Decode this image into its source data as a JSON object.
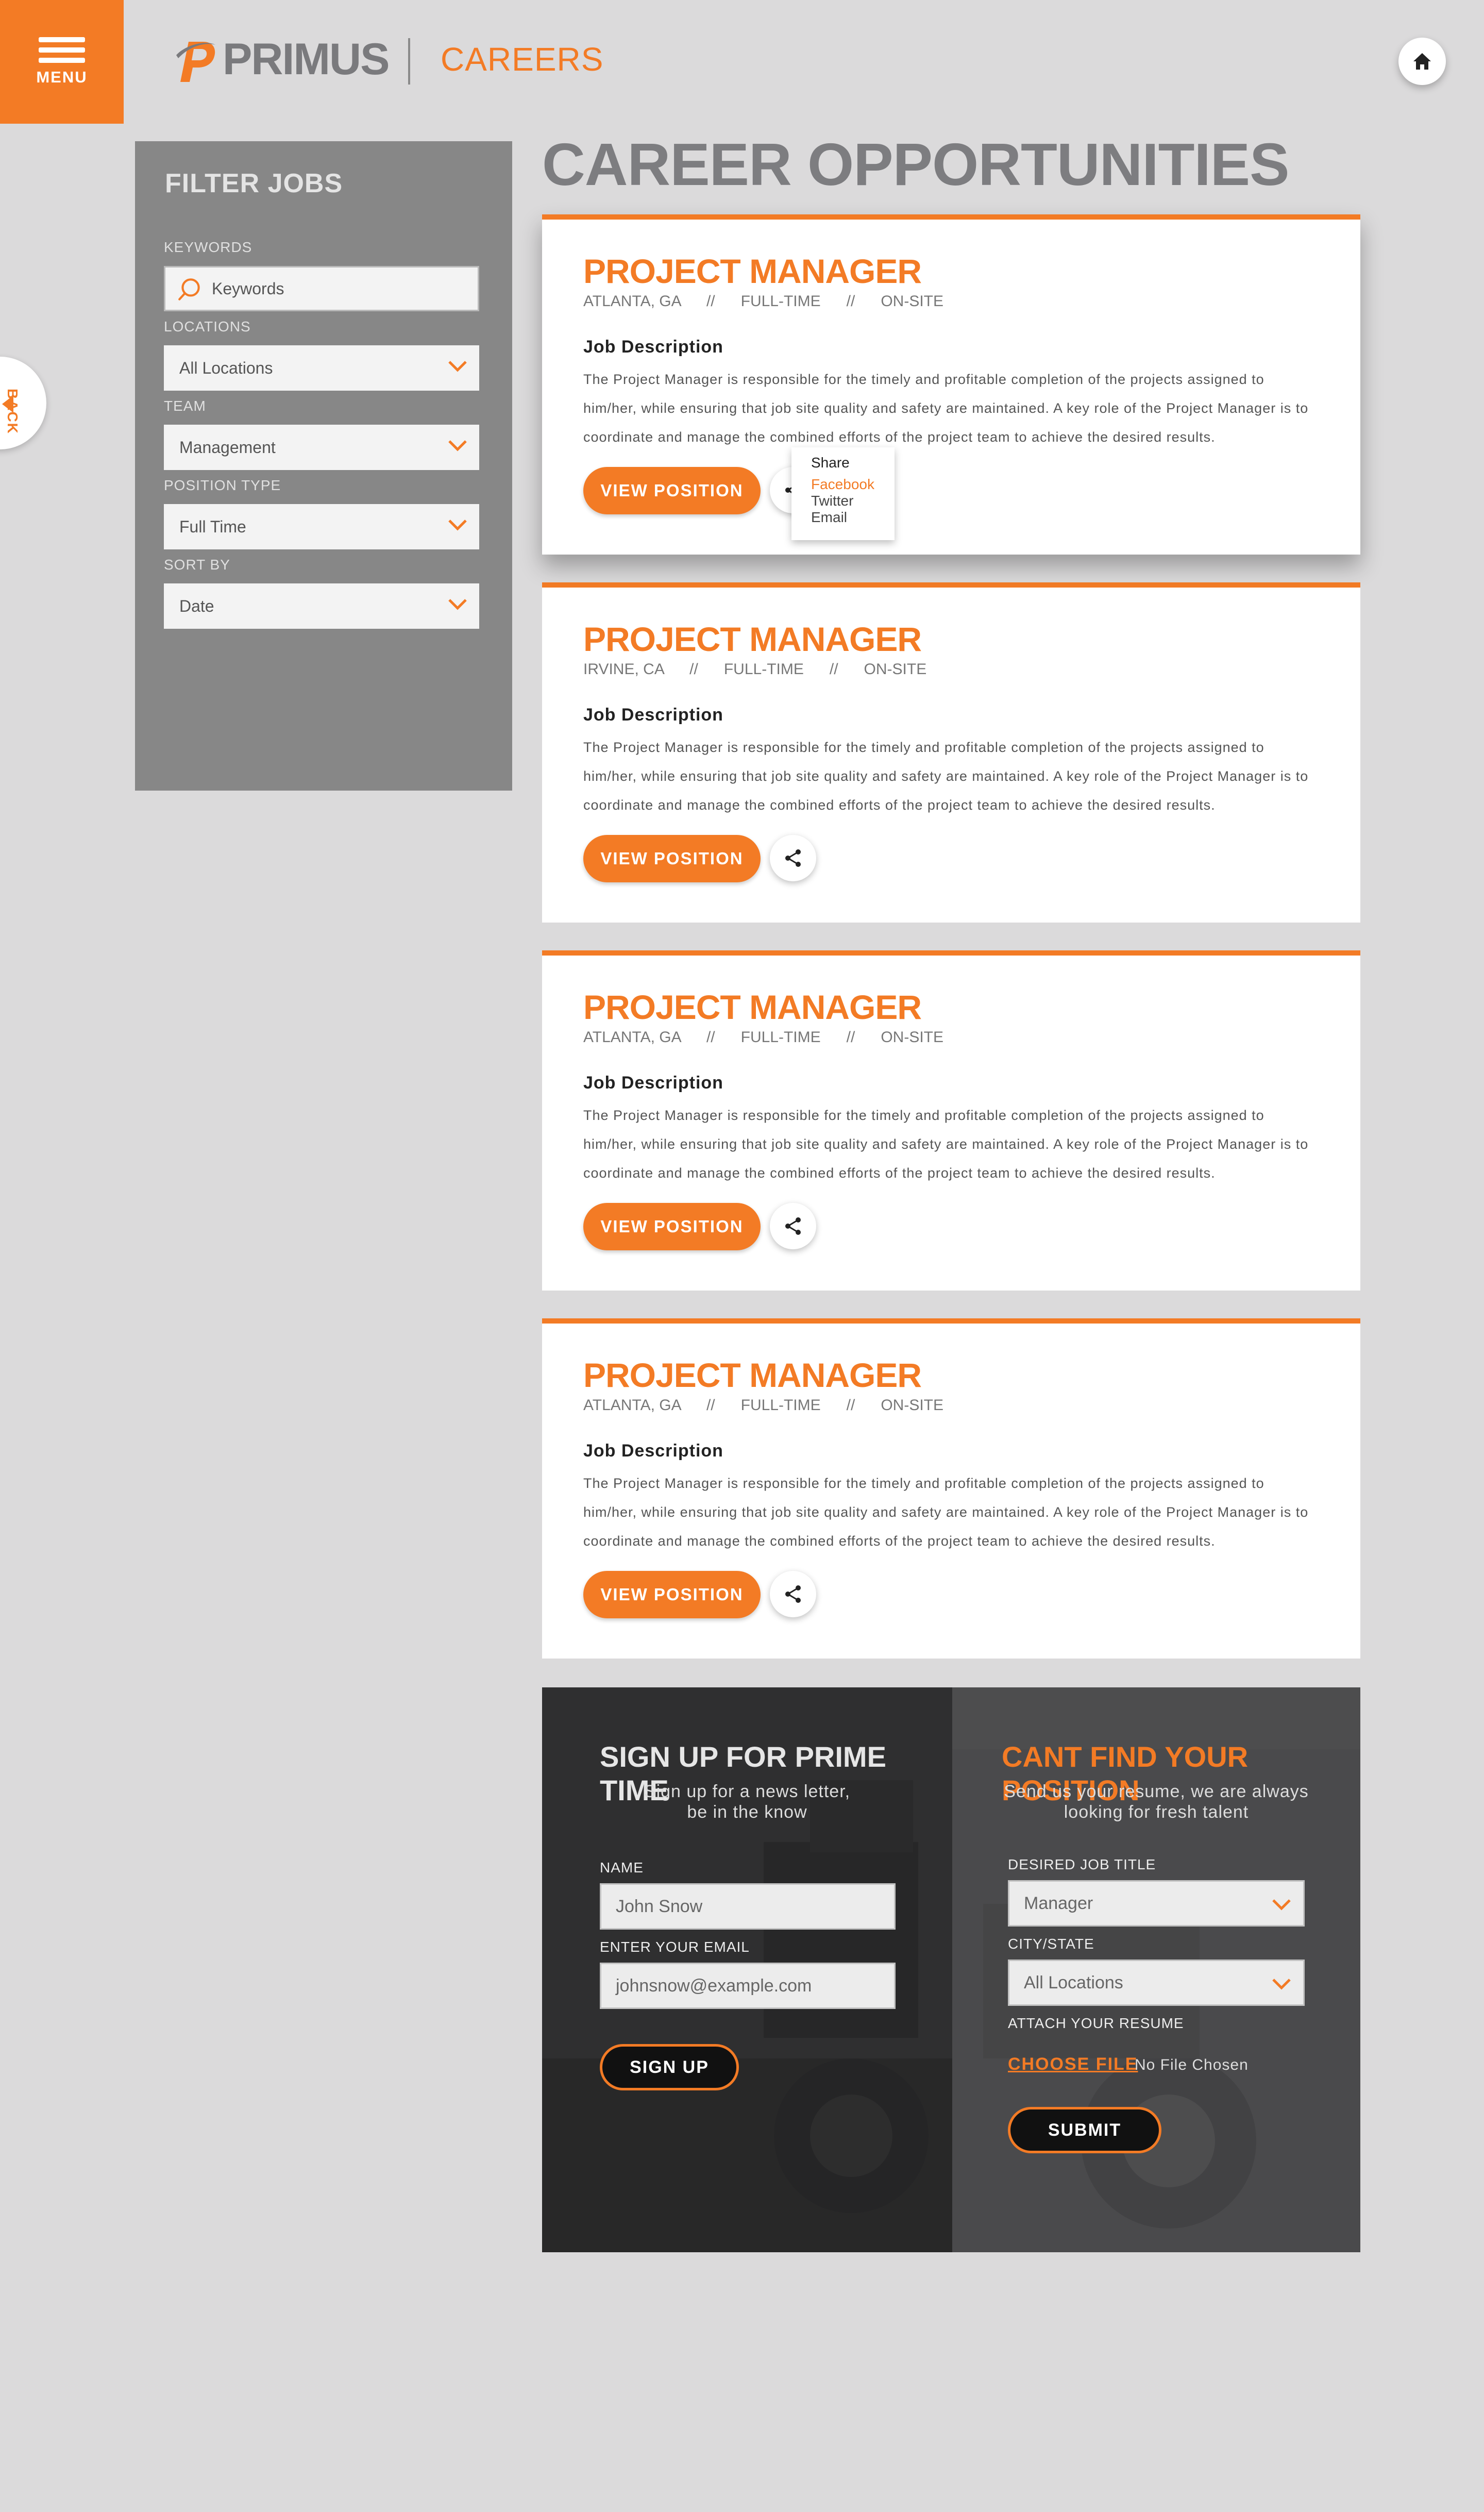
{
  "header": {
    "menu_label": "MENU",
    "logo_text": "PRIMUS",
    "section_title": "CAREERS",
    "back_label": "BACK"
  },
  "filter": {
    "title": "FILTER JOBS",
    "keywords_label": "KEYWORDS",
    "keywords_placeholder": "Keywords",
    "locations_label": "LOCATIONS",
    "locations_value": "All Locations",
    "team_label": "TEAM",
    "team_value": "Management",
    "position_type_label": "POSITION TYPE",
    "position_type_value": "Full Time",
    "sort_label": "SORT BY",
    "sort_value": "Date"
  },
  "page_title": "CAREER OPPORTUNITIES",
  "jobs": [
    {
      "title": "PROJECT MANAGER",
      "meta": "ATLANTA, GA      //      FULL-TIME      //      ON-SITE",
      "jd_label": "Job Description",
      "description": "The Project Manager is responsible for the timely and profitable completion of the projects assigned to him/her, while ensuring that job site quality and safety are maintained. A key role of the Project Manager is to coordinate and manage the combined efforts of the project team to achieve the desired results.",
      "button": "VIEW POSITION"
    },
    {
      "title": "PROJECT MANAGER",
      "meta": "IRVINE, CA      //      FULL-TIME      //      ON-SITE",
      "jd_label": "Job Description",
      "description": "The Project Manager is responsible for the timely and profitable completion of the projects assigned to him/her, while ensuring that job site quality and safety are maintained. A key role of the Project Manager is to coordinate and manage the combined efforts of the project team to achieve the desired results.",
      "button": "VIEW POSITION"
    },
    {
      "title": "PROJECT MANAGER",
      "meta": "ATLANTA, GA      //      FULL-TIME      //      ON-SITE",
      "jd_label": "Job Description",
      "description": "The Project Manager is responsible for the timely and profitable completion of the projects assigned to him/her, while ensuring that job site quality and safety are maintained. A key role of the Project Manager is to coordinate and manage the combined efforts of the project team to achieve the desired results.",
      "button": "VIEW POSITION"
    },
    {
      "title": "PROJECT MANAGER",
      "meta": "ATLANTA, GA      //      FULL-TIME      //      ON-SITE",
      "jd_label": "Job Description",
      "description": "The Project Manager is responsible for the timely and profitable completion of the projects assigned to him/her, while ensuring that job site quality and safety are maintained. A key role of the Project Manager is to coordinate and manage the combined efforts of the project team to achieve the desired results.",
      "button": "VIEW POSITION"
    }
  ],
  "share_menu": {
    "title": "Share",
    "facebook": "Facebook",
    "twitter": "Twitter",
    "email": "Email"
  },
  "signup": {
    "title": "SIGN UP FOR PRIME TIME",
    "subtitle_line1": "Sign up for a news letter,",
    "subtitle_line2": "be in the know",
    "name_label": "NAME",
    "name_value": "John Snow",
    "email_label": "ENTER YOUR EMAIL",
    "email_value": "johnsnow@example.com",
    "button": "SIGN UP"
  },
  "resume": {
    "title": "CANT FIND YOUR POSITION",
    "subtitle_line1": "Send us your resume, we are always",
    "subtitle_line2": "looking for fresh talent",
    "job_title_label": "DESIRED JOB TITLE",
    "job_title_value": "Manager",
    "city_label": "CITY/STATE",
    "city_value": "All Locations",
    "attach_label": "ATTACH YOUR RESUME",
    "choose_file": "CHOOSE FILE",
    "no_file": "No File Chosen",
    "button": "SUBMIT"
  },
  "colors": {
    "accent": "#f37b25",
    "background": "#dbdadb",
    "filter_panel": "#878787",
    "heading_gray": "#7d7d80"
  }
}
